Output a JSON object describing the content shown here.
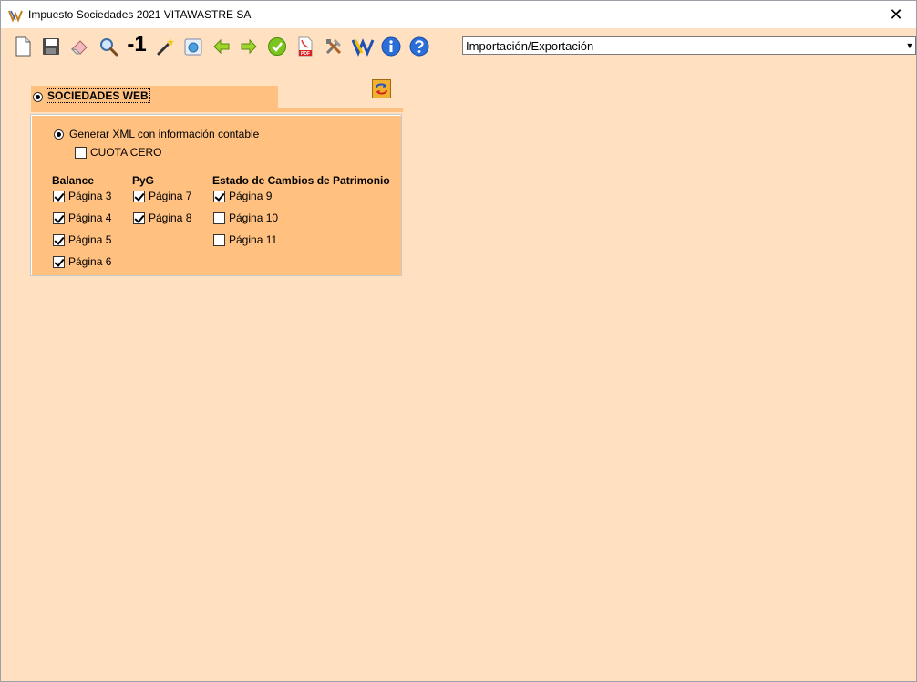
{
  "window": {
    "title": "Impuesto Sociedades 2021 VITAWASTRE SA",
    "close_glyph": "✕"
  },
  "toolbar": {
    "icons": [
      "new-document-icon",
      "save-icon",
      "eraser-icon",
      "magnifier-icon",
      "minus-one-icon",
      "magic-wand-icon",
      "globe-icon",
      "arrow-left-icon",
      "arrow-right-icon",
      "check-icon",
      "pdf-icon",
      "tools-icon",
      "aeat-logo-icon",
      "info-icon",
      "help-icon"
    ],
    "minus_one_label": "-1",
    "pdf_label": "PDF",
    "combo": {
      "selected": "Importación/Exportación"
    }
  },
  "section": {
    "label": "SOCIEDADES WEB",
    "option_xml": "Generar XML con información contable",
    "cuota_cero": "CUOTA CERO",
    "columns": [
      {
        "title": "Balance",
        "pages": [
          {
            "label": "Página 3",
            "checked": true
          },
          {
            "label": "Página 4",
            "checked": true
          },
          {
            "label": "Página 5",
            "checked": true
          },
          {
            "label": "Página 6",
            "checked": true
          }
        ]
      },
      {
        "title": "PyG",
        "pages": [
          {
            "label": "Página 7",
            "checked": true
          },
          {
            "label": "Página 8",
            "checked": true
          }
        ]
      },
      {
        "title": "Estado de Cambios de Patrimonio",
        "pages": [
          {
            "label": "Página 9",
            "checked": true
          },
          {
            "label": "Página 10",
            "checked": false
          },
          {
            "label": "Página 11",
            "checked": false
          }
        ]
      }
    ]
  },
  "colors": {
    "background": "#ffe0c0",
    "panel": "#ffc080"
  }
}
